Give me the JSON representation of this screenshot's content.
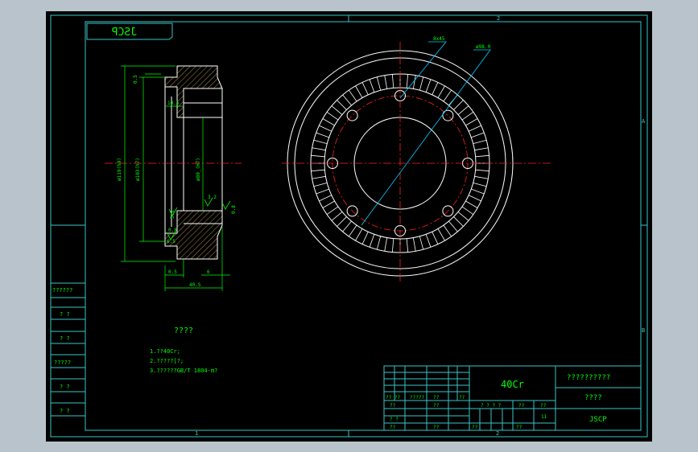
{
  "colors": {
    "frame_outer": "#b9c3cc",
    "canvas": "#000000",
    "frame_line": "#39c6c6",
    "part_line": "#ffffff",
    "hatch": "#d9b25a",
    "center_line": "#ff2020",
    "dimension": "#00ff00",
    "leader": "#00d0ff"
  },
  "frame": {
    "top_zones": [
      "1",
      "2"
    ],
    "right_zones": [
      "A",
      "B"
    ],
    "bottom_zones": [
      "1",
      "2"
    ],
    "stamp_mirrored": "JSCP"
  },
  "left_column": {
    "labels": [
      "??????",
      "? ?",
      "? ?",
      "?????",
      "? ?",
      "? ?"
    ]
  },
  "section_view": {
    "dims": {
      "top_h": "0.5",
      "offset1": "10.5",
      "dia_outer": "ø119(h9)",
      "dia_mid": "ø103(h7)",
      "dia_bore": "ø80_(H7)",
      "chamfer1": "3.2",
      "chamfer2": "0.8",
      "chamfer3": "3.2",
      "chamfer4": "0.8",
      "chamfer5": "6.5",
      "bottom_small": "0.5",
      "bottom_len": "6",
      "total_len": "40.5"
    }
  },
  "front_view": {
    "labels": {
      "hole_pattern": "8x45",
      "pitch_circle": "ø98.0"
    },
    "tooth_count": 72,
    "hole_count": 8
  },
  "notes": {
    "heading": "????",
    "lines": [
      "1.??40Cr;",
      "2.?????[?;",
      "3.??????GB/T 1804-m?"
    ]
  },
  "title_block": {
    "material": "40Cr",
    "company": "??????????",
    "drawing_name": "????",
    "drawing_code": "JSCP",
    "cells": {
      "r1": "??  ??",
      "r2": "?????",
      "r3": "??",
      "r4": "??",
      "r5": "??",
      "r6": "? ? ? ?",
      "r7": "??",
      "r8": "??",
      "r9": "??",
      "r10": "11",
      "r11": "? ?",
      "r12": "??",
      "r13": "??",
      "r14": "??",
      "r15": "??"
    }
  }
}
